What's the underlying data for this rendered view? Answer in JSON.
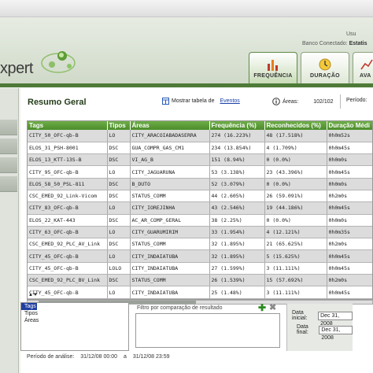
{
  "header": {
    "logo_text": "xpert",
    "user_label": "Usu",
    "bank_label": "Banco Conectado:",
    "bank_value": "Estatis"
  },
  "tabs": [
    {
      "label": "Frequência",
      "icon": "bar-chart-icon",
      "active": true
    },
    {
      "label": "Duração",
      "icon": "clock-icon",
      "active": false
    },
    {
      "label": "Ava",
      "icon": "analysis-icon",
      "active": false
    }
  ],
  "summary": {
    "title": "Resumo Geral",
    "show_table_label": "Mostrar tabela de",
    "show_table_link": "Eventos",
    "areas_label": "Áreas:",
    "areas_count": "102/102",
    "period_label": "Período:"
  },
  "table": {
    "columns": [
      "Tags",
      "Tipos",
      "Áreas",
      "Frequência (%)",
      "Reconhecidos (%)",
      "Duração Médi"
    ],
    "rows": [
      [
        "CITY_50_OFC-qb-B",
        "LO",
        "CITY_ARACOIABADASERRA",
        "274 (16.223%)",
        "48 (17.518%)",
        "0h0m52s"
      ],
      [
        "ELOS_31_PSH-8001",
        "DSC",
        "GUA_COMPR_GAS_CM1",
        "234 (13.854%)",
        "4 (1.709%)",
        "0h0m45s"
      ],
      [
        "ELOS_13_KTT-13S-B",
        "DSC",
        "VI_AG_B",
        "151 (8.94%)",
        "0 (0.0%)",
        "0h0m0s"
      ],
      [
        "CITY_95_OFC-qb-B",
        "LO",
        "CITY_JAGUARUNA",
        "53 (3.138%)",
        "23 (43.396%)",
        "0h0m45s"
      ],
      [
        "ELOS_58_50_PSL-811",
        "DSC",
        "B_DUTO",
        "52 (3.079%)",
        "0 (0.0%)",
        "0h0m0s"
      ],
      [
        "CSC_EMED_92_Link-Vicom",
        "DSC",
        "STATUS_COMM",
        "44 (2.605%)",
        "26 (59.091%)",
        "0h2m0s"
      ],
      [
        "CITY_83_OFC-qb-B",
        "LO",
        "CITY_IOREJINHA",
        "43 (2.546%)",
        "19 (44.186%)",
        "0h0m45s"
      ],
      [
        "ELOS_22_KAT-443",
        "DSC",
        "AC_AR_COMP_GERAL",
        "38 (2.25%)",
        "0 (0.0%)",
        "0h0m0s"
      ],
      [
        "CITY_63_OFC-qb-B",
        "LO",
        "CITY_GUARUMIRIM",
        "33 (1.954%)",
        "4 (12.121%)",
        "0h0m35s"
      ],
      [
        "CSC_EMED_92_PLC_AV_Link",
        "DSC",
        "STATUS_COMM",
        "32 (1.895%)",
        "21 (65.625%)",
        "0h2m0s"
      ],
      [
        "CITY_45_OFC-qb-B",
        "LO",
        "CITY_INDAIATUBA",
        "32 (1.895%)",
        "5 (15.625%)",
        "0h0m45s"
      ],
      [
        "CITY_45_OFC-qb-B",
        "LOLO",
        "CITY_INDAIATUBA",
        "27 (1.599%)",
        "3 (11.111%)",
        "0h0m45s"
      ],
      [
        "CSC_EMED_92_PLC_BV_Link",
        "DSC",
        "STATUS_COMM",
        "26 (1.539%)",
        "15 (57.692%)",
        "0h2m0s"
      ],
      [
        "CITY_45_OFC-qb-B",
        "LO",
        "CITY_INDAIATUBA",
        "25 (1.48%)",
        "3 (11.111%)",
        "0h0m45s"
      ]
    ]
  },
  "filter": {
    "options": [
      "Tags",
      "Tipos",
      "Áreas"
    ],
    "selected": "Tags",
    "compare_title": "Filtro por comparação de resultado"
  },
  "dates": {
    "start_label": "Data inicial:",
    "start_value": "Dec 31, 2008",
    "end_label": "Data final:",
    "end_value": "Dec 31, 2008"
  },
  "footer": {
    "label": "Período de análise:",
    "start": "31/12/08 00:00",
    "separator": "a",
    "end": "31/12/08 23:59"
  },
  "colors": {
    "accent_green": "#4b8c2a",
    "header_green": "#6fae48",
    "link_blue": "#1a3fa6"
  }
}
